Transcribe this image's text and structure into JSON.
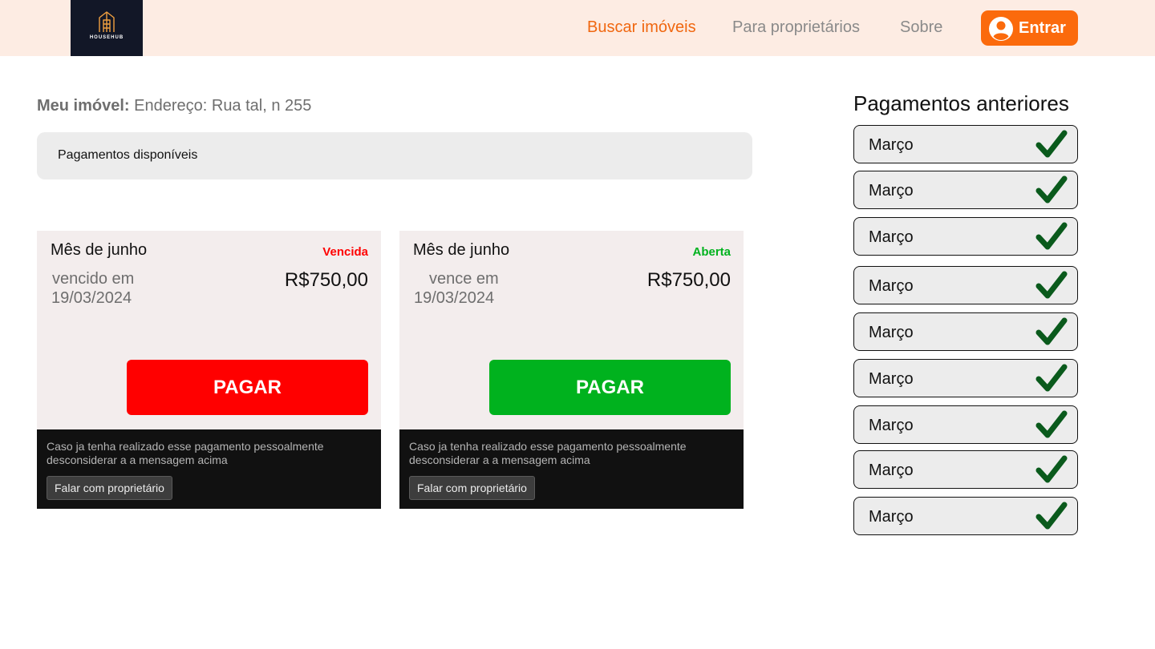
{
  "brand": {
    "name": "HOUSEHUB",
    "logo_icon": "building-icon"
  },
  "nav": {
    "links": [
      "Buscar imóveis",
      "Para proprietários",
      "Sobre"
    ],
    "login_label": "Entrar",
    "active_color": "#f06710",
    "accent": "#fb6a0c"
  },
  "property": {
    "label": "Meu imóvel:",
    "address": "Endereço: Rua tal, n 255"
  },
  "available_title": "Pagamentos disponíveis",
  "cards": [
    {
      "month": "Mês de junho",
      "status": "Vencida",
      "status_color": "#ff0000",
      "due_label": "vencido em",
      "due_date": "19/03/2024",
      "amount": "R$750,00",
      "pay_label": "PAGAR",
      "pay_color": "#ff0000",
      "notice": "Caso ja tenha realizado esse pagamento pessoalmente desconsiderar a a mensagem acima",
      "contact_label": "Falar com proprietário"
    },
    {
      "month": "Mês de junho",
      "status": "Aberta",
      "status_color": "#00b21e",
      "due_label": "vence em",
      "due_date": "19/03/2024",
      "amount": "R$750,00",
      "pay_label": "PAGAR",
      "pay_color": "#00b21e",
      "notice": "Caso ja tenha realizado esse pagamento pessoalmente desconsiderar a a mensagem acima",
      "contact_label": "Falar com proprietário"
    }
  ],
  "history": {
    "title": "Pagamentos anteriores",
    "check_icon": "checkmark-icon",
    "check_color": "#0a5a1c",
    "items": [
      "Março",
      "Março",
      "Março",
      "Março",
      "Março",
      "Março",
      "Março",
      "Março",
      "Março"
    ]
  }
}
